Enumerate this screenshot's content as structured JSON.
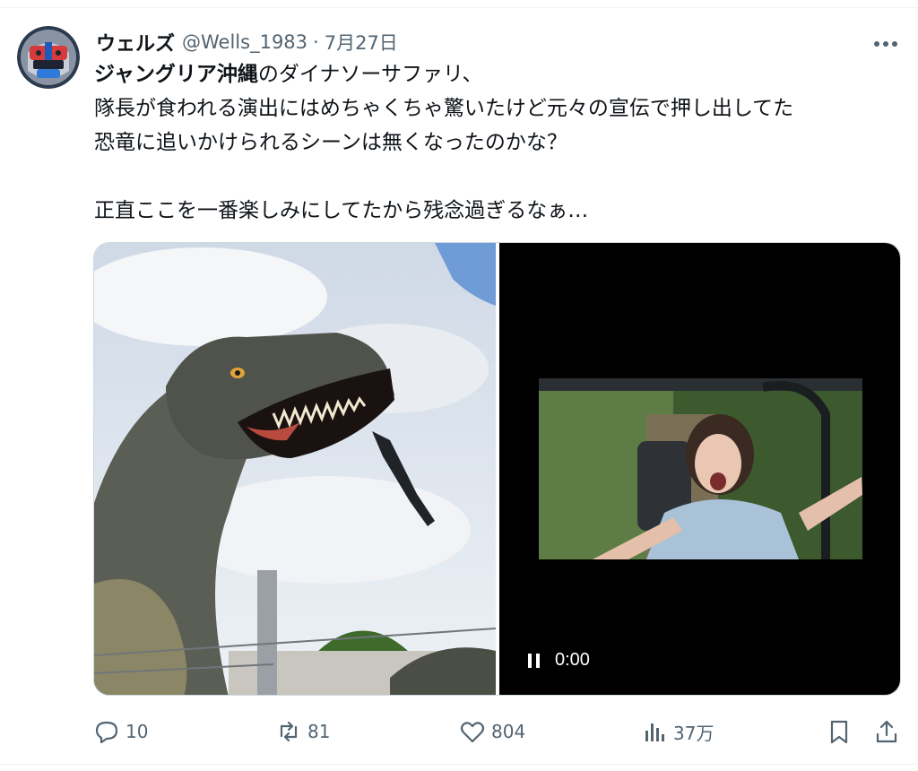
{
  "tweet": {
    "author": {
      "display_name": "ウェルズ",
      "handle": "@Wells_1983",
      "separator": "·",
      "date": "7月27日"
    },
    "text": {
      "line1_bold": "ジャングリア沖縄",
      "line1_rest": "のダイナソーサファリ、",
      "line2": "隊長が食われる演出にはめちゃくちゃ驚いたけど元々の宣伝で押し出してた",
      "line3": "恐竜に追いかけられるシーンは無くなったのかな？",
      "line4": "正直ここを一番楽しみにしてたから残念過ぎるなぁ…"
    },
    "video": {
      "time": "0:00",
      "state": "playing"
    },
    "stats": {
      "replies": "10",
      "reposts": "81",
      "likes": "804",
      "views": "37万"
    },
    "icons": {
      "more": "more-dots-icon",
      "reply": "reply-bubble-icon",
      "repost": "repost-icon",
      "like": "heart-icon",
      "views": "views-bars-icon",
      "bookmark": "bookmark-icon",
      "share": "share-icon",
      "pause": "pause-icon"
    },
    "colors": {
      "text": "#0f1419",
      "secondary": "#536471",
      "border": "#cfd9de"
    }
  }
}
